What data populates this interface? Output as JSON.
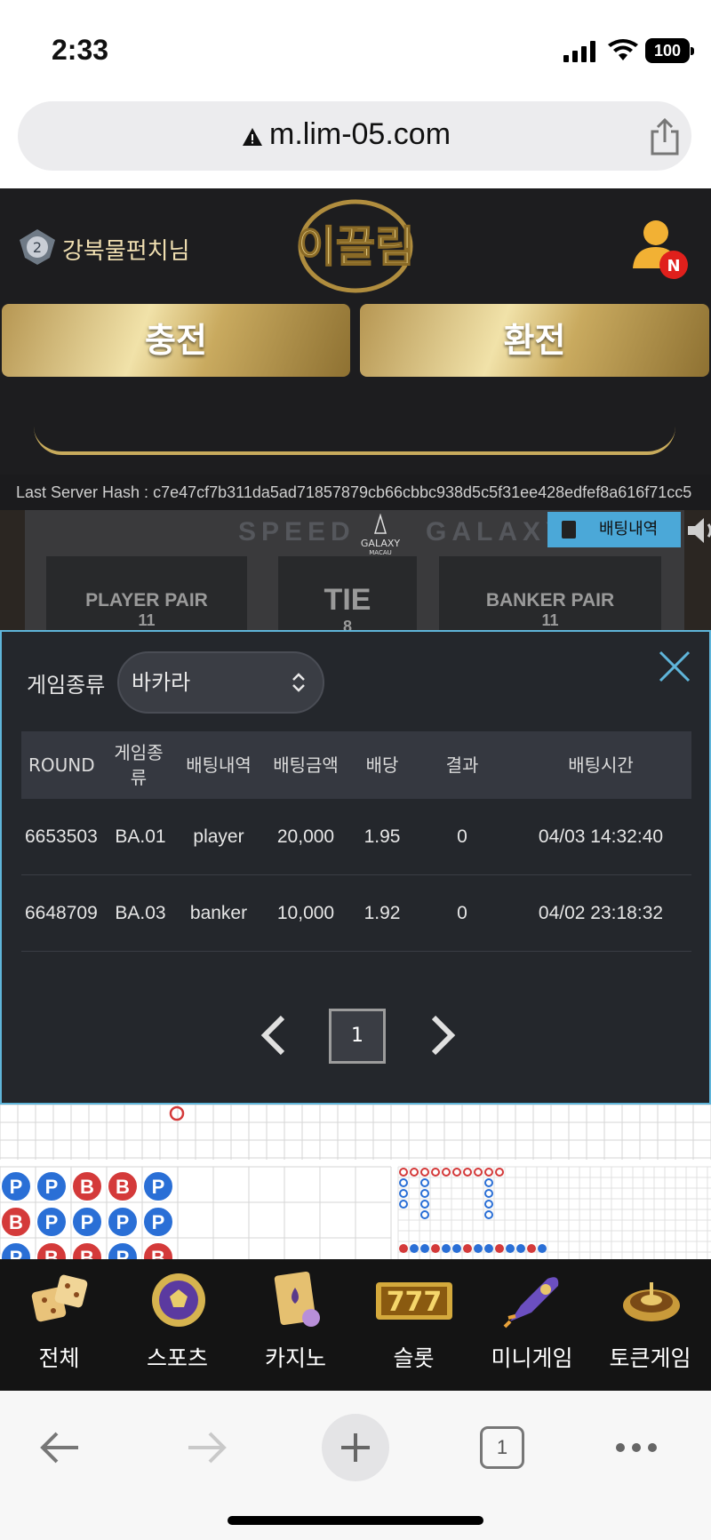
{
  "status_bar": {
    "time": "2:33",
    "battery": "100"
  },
  "browser": {
    "url": "m.lim-05.com",
    "tab_count": "1"
  },
  "header": {
    "username": "강북물펀치님",
    "logo_text": "이끌림",
    "profile_badge": "N",
    "charge_label": "충전",
    "withdraw_label": "환전"
  },
  "server_hash": "Last Server Hash : c7e47cf7b311da5ad71857879cb66cbbc938d5c5f31ee428edfef8a616f71cc5",
  "game": {
    "title_left": "SPEED",
    "title_right": "GALAXY",
    "brand": "GALAXY",
    "brand_sub": "MACAU",
    "bet_history_label": "배팅내역",
    "boxes": [
      {
        "label": "PLAYER PAIR",
        "count": "11"
      },
      {
        "label": "TIE",
        "count": "8"
      },
      {
        "label": "BANKER PAIR",
        "count": "11"
      }
    ]
  },
  "modal": {
    "game_type_label": "게임종류",
    "game_type_value": "바카라",
    "columns": [
      "ROUND",
      "게임종류",
      "배팅내역",
      "배팅금액",
      "배당",
      "결과",
      "배팅시간"
    ],
    "rows": [
      [
        "6653503",
        "BA.01",
        "player",
        "20,000",
        "1.95",
        "0",
        "04/03 14:32:40"
      ],
      [
        "6648709",
        "BA.03",
        "banker",
        "10,000",
        "1.92",
        "0",
        "04/02 23:18:32"
      ]
    ],
    "current_page": "1"
  },
  "bead_road": [
    [
      "P",
      "P",
      "B",
      "B",
      "P"
    ],
    [
      "B",
      "P",
      "P",
      "P",
      "P"
    ],
    [
      "P",
      "B",
      "B",
      "P",
      "B"
    ]
  ],
  "categories": [
    {
      "label": "전체",
      "icon": "dice-icon"
    },
    {
      "label": "스포츠",
      "icon": "soccer-ball-icon"
    },
    {
      "label": "카지노",
      "icon": "cards-icon"
    },
    {
      "label": "슬롯",
      "icon": "slot-777-icon",
      "icon_text": "777"
    },
    {
      "label": "미니게임",
      "icon": "rocket-icon"
    },
    {
      "label": "토큰게임",
      "icon": "roulette-icon"
    }
  ],
  "colors": {
    "accent": "#5fb5da",
    "gold": "#d4b66a",
    "player": "#2a6fd6",
    "banker": "#d43a3a"
  }
}
